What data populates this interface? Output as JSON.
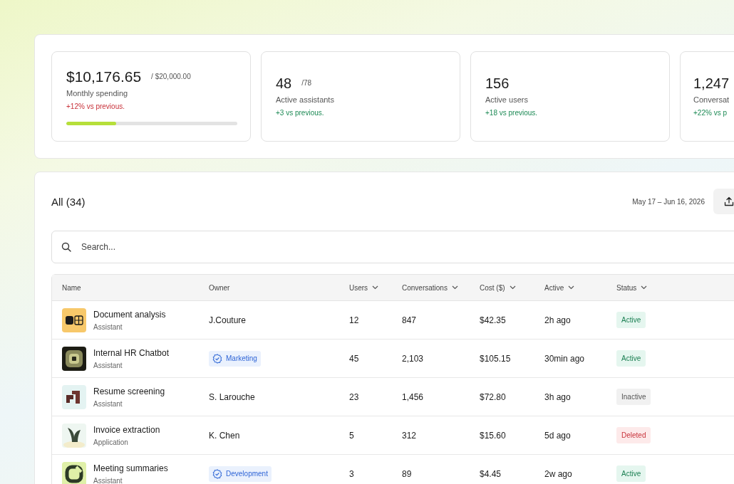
{
  "stats": [
    {
      "value": "$10,176.65",
      "suffix": "/ $20,000.00",
      "label": "Monthly spending",
      "delta": "+12% vs previous.",
      "kind": "negative",
      "level": 0.29
    },
    {
      "value": "48",
      "suffix": "/78",
      "label": "Active assistants",
      "delta": "+3 vs previous.",
      "kind": "positive"
    },
    {
      "value": "156",
      "label": "Active users",
      "delta": "+18 vs previous.",
      "kind": "positive"
    },
    {
      "value": "1,247",
      "label": "Conversat",
      "delta": "+22% vs p",
      "kind": "positive"
    }
  ],
  "list": {
    "title": "All (34)",
    "date_range": "May 17 – Jun 16, 2026",
    "search": {
      "placeholder": "Search..."
    },
    "columns": [
      {
        "label": "Name",
        "sortable": false
      },
      {
        "label": "Owner",
        "sortable": false
      },
      {
        "label": "Users",
        "sortable": true
      },
      {
        "label": "Conversations",
        "sortable": true
      },
      {
        "label": "Cost ($)",
        "sortable": true
      },
      {
        "label": "Active",
        "sortable": true
      },
      {
        "label": "Status",
        "sortable": true
      }
    ],
    "rows": [
      {
        "name": "Document analysis",
        "type": "Assistant",
        "owner": {
          "kind": "person",
          "text": "J.Couture"
        },
        "users": "12",
        "conversations": "847",
        "cost": "$42.35",
        "active": "2h ago",
        "status": {
          "kind": "active",
          "text": "Active"
        }
      },
      {
        "name": "Internal HR Chatbot",
        "type": "Assistant",
        "owner": {
          "kind": "team",
          "text": "Marketing"
        },
        "users": "45",
        "conversations": "2,103",
        "cost": "$105.15",
        "active": "30min ago",
        "status": {
          "kind": "active",
          "text": "Active"
        }
      },
      {
        "name": "Resume screening",
        "type": "Assistant",
        "owner": {
          "kind": "person",
          "text": "S. Larouche"
        },
        "users": "23",
        "conversations": "1,456",
        "cost": "$72.80",
        "active": "3h ago",
        "status": {
          "kind": "inactive",
          "text": "Inactive"
        }
      },
      {
        "name": "Invoice extraction",
        "type": "Application",
        "owner": {
          "kind": "person",
          "text": "K. Chen"
        },
        "users": "5",
        "conversations": "312",
        "cost": "$15.60",
        "active": "5d ago",
        "status": {
          "kind": "deleted",
          "text": "Deleted"
        }
      },
      {
        "name": "Meeting summaries",
        "type": "Assistant",
        "owner": {
          "kind": "team",
          "text": "Development"
        },
        "users": "3",
        "conversations": "89",
        "cost": "$4.45",
        "active": "2w ago",
        "status": {
          "kind": "active",
          "text": "Active"
        }
      }
    ]
  }
}
